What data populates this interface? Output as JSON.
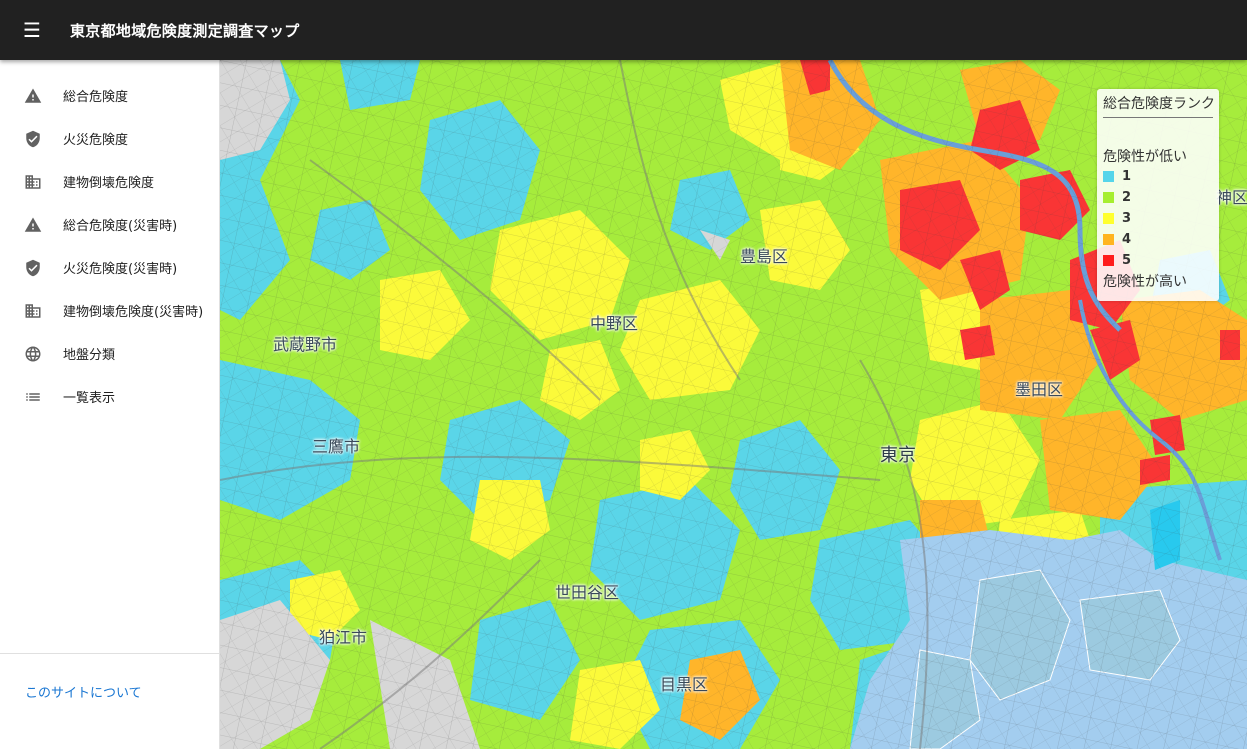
{
  "app": {
    "title": "東京都地域危険度測定調査マップ"
  },
  "nav": {
    "items": [
      {
        "label": "総合危険度",
        "icon": "warning-icon"
      },
      {
        "label": "火災危険度",
        "icon": "shield-icon"
      },
      {
        "label": "建物倒壊危険度",
        "icon": "building-icon"
      },
      {
        "label": "総合危険度(災害時)",
        "icon": "warning-icon"
      },
      {
        "label": "火災危険度(災害時)",
        "icon": "shield-icon"
      },
      {
        "label": "建物倒壊危険度(災害時)",
        "icon": "building-icon"
      },
      {
        "label": "地盤分類",
        "icon": "globe-icon"
      },
      {
        "label": "一覧表示",
        "icon": "list-icon"
      }
    ],
    "about": "このサイトについて"
  },
  "map": {
    "labels": [
      "豊島区",
      "中野区",
      "武蔵野市",
      "三鷹市",
      "墨田区",
      "東京",
      "世田谷区",
      "狛江市",
      "目黒区",
      "神区"
    ]
  },
  "legend": {
    "title": "総合危険度ランク",
    "low_label": "危険性が低い",
    "high_label": "危険性が高い",
    "ranks": [
      {
        "value": "1",
        "color": "#55d5ea"
      },
      {
        "value": "2",
        "color": "#a6ee2f"
      },
      {
        "value": "3",
        "color": "#ffff2e"
      },
      {
        "value": "4",
        "color": "#ffb41f"
      },
      {
        "value": "5",
        "color": "#ff1c1c"
      }
    ]
  },
  "colors": {
    "appbar": "#212121",
    "accent_link": "#1976d2",
    "water": "#a3cdef"
  }
}
